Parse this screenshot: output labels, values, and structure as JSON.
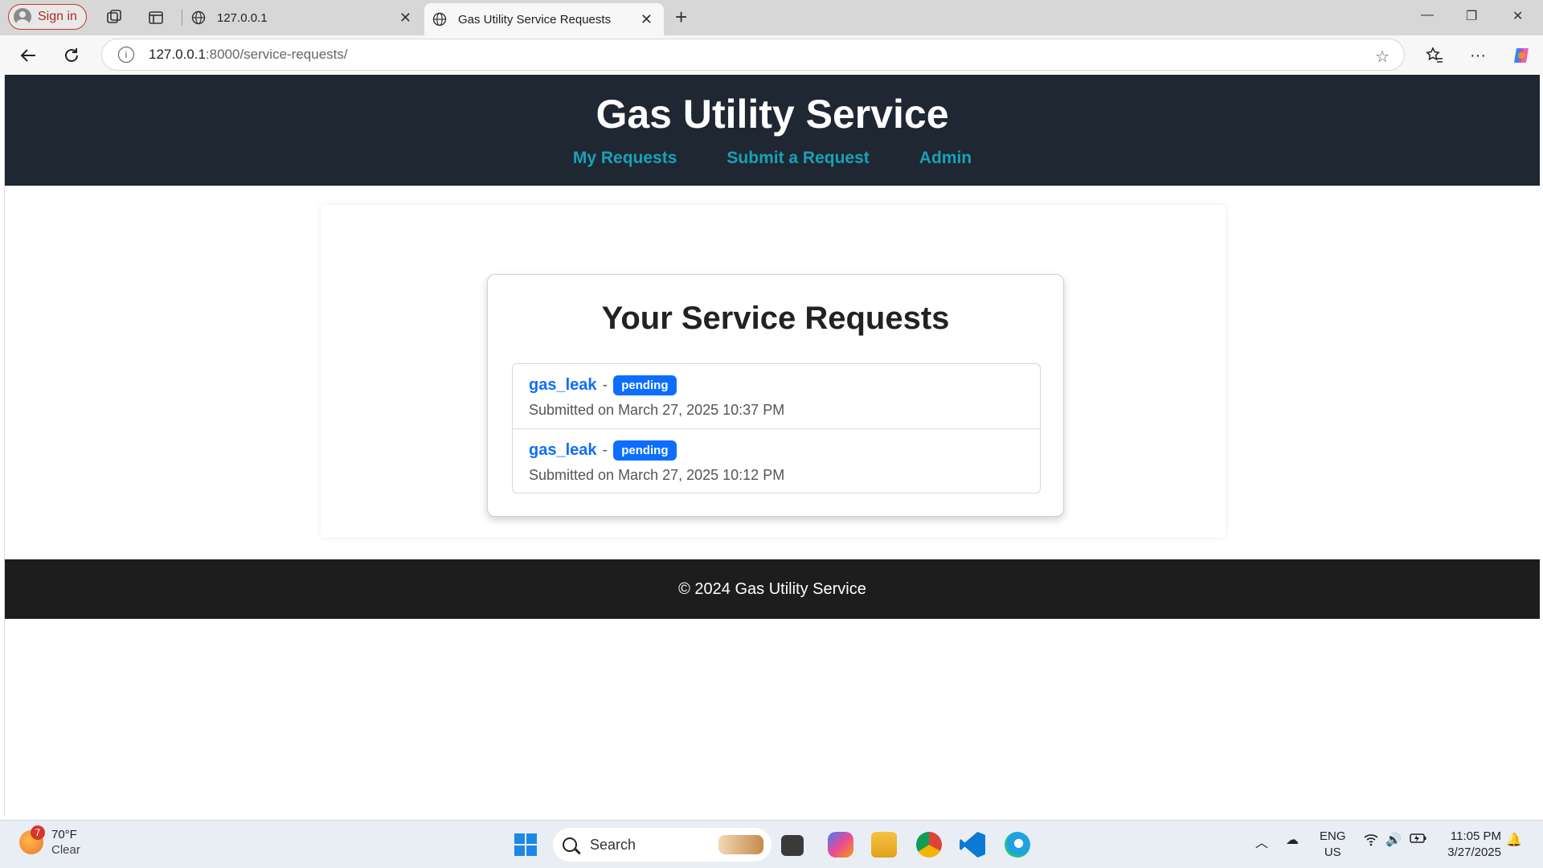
{
  "browser": {
    "signin_label": "Sign in",
    "tabs": [
      {
        "title": "127.0.0.1",
        "active": false
      },
      {
        "title": "Gas Utility Service Requests",
        "active": true
      }
    ],
    "address": {
      "host": "127.0.0.1",
      "path": ":8000/service-requests/"
    }
  },
  "site": {
    "title": "Gas Utility Service",
    "nav": [
      {
        "label": "My Requests"
      },
      {
        "label": "Submit a Request"
      },
      {
        "label": "Admin"
      }
    ],
    "link_color": "#17a2b8",
    "header_color": "#1f2733"
  },
  "requests_card": {
    "heading": "Your Service Requests",
    "items": [
      {
        "type": "gas_leak",
        "status": "pending",
        "submitted": "Submitted on March 27, 2025 10:37 PM"
      },
      {
        "type": "gas_leak",
        "status": "pending",
        "submitted": "Submitted on March 27, 2025 10:12 PM"
      }
    ],
    "separator": "-",
    "badge_color": "#0d6efd"
  },
  "footer": {
    "text": "© 2024 Gas Utility Service"
  },
  "taskbar": {
    "weather": {
      "temp": "70°F",
      "condition": "Clear",
      "alert_count": "7"
    },
    "search_placeholder": "Search",
    "language": {
      "line1": "ENG",
      "line2": "US"
    },
    "clock": {
      "time": "11:05 PM",
      "date": "3/27/2025"
    }
  }
}
